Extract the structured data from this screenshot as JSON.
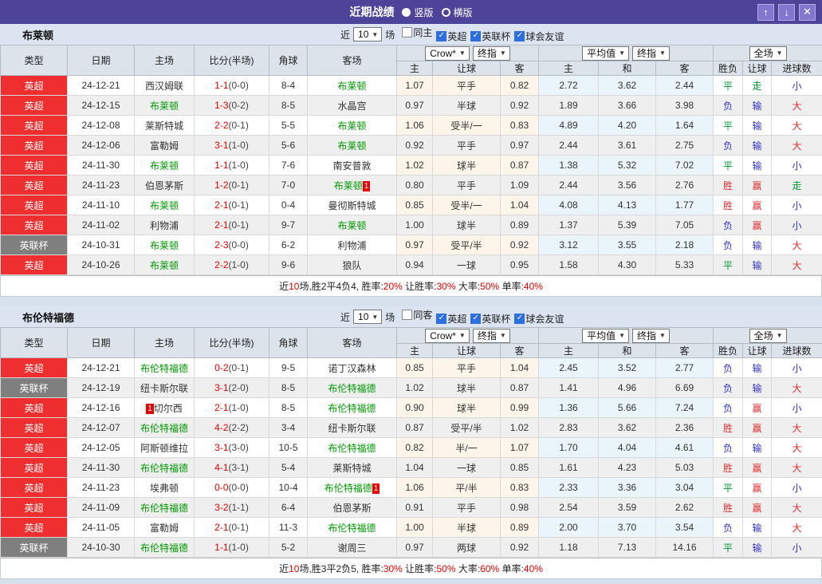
{
  "colors": {
    "accent_purple": "#4d4398",
    "league_red": "#ef2f2f",
    "league_gray": "#7f7f7f",
    "focus_team_green": "#009900",
    "score_red": "#e60000",
    "result_win_red": "#e03030",
    "result_draw_green": "#009933",
    "result_lose_blue": "#3232c8"
  },
  "titlebar": {
    "title": "近期战绩",
    "layout_options": [
      {
        "label": "竖版",
        "selected": true
      },
      {
        "label": "横版",
        "selected": false
      }
    ],
    "buttons": {
      "up": "↑",
      "down": "↓",
      "close": "✕"
    }
  },
  "table_header": {
    "main_cols": [
      "类型",
      "日期",
      "主场",
      "比分(半场)",
      "角球",
      "客场"
    ],
    "group_dropdowns": [
      [
        "Crow*",
        "终指"
      ],
      [
        "平均值",
        "终指"
      ],
      [
        "全场"
      ]
    ],
    "sub_cols": [
      "主",
      "让球",
      "客",
      "主",
      "和",
      "客",
      "胜负",
      "让球",
      "进球数"
    ]
  },
  "outcome_colors": {
    "胜": "win",
    "赢": "win",
    "大": "win",
    "平": "draw",
    "走": "draw",
    "负": "lose",
    "输": "lose",
    "小": "lose"
  },
  "sections": [
    {
      "team": "布莱顿",
      "filter": {
        "prefix": "近",
        "count": "10",
        "suffix": "场",
        "checkboxes": [
          {
            "label": "同主",
            "checked": false
          },
          {
            "label": "英超",
            "checked": true
          },
          {
            "label": "英联杯",
            "checked": true
          },
          {
            "label": "球会友谊",
            "checked": true
          }
        ]
      },
      "rows": [
        {
          "league": "英超",
          "league_type": "red",
          "date": "24-12-21",
          "home": {
            "name": "西汉姆联",
            "focus": false
          },
          "score_ft": "1-1",
          "score_ht": "(0-0)",
          "corners": "8-4",
          "away": {
            "name": "布莱顿",
            "focus": true
          },
          "odds": [
            "1.07",
            "平手",
            "0.82",
            "2.72",
            "3.62",
            "2.44"
          ],
          "outcome": [
            "平",
            "走",
            "小"
          ]
        },
        {
          "league": "英超",
          "league_type": "red",
          "date": "24-12-15",
          "home": {
            "name": "布莱顿",
            "focus": true
          },
          "score_ft": "1-3",
          "score_ht": "(0-2)",
          "corners": "8-5",
          "away": {
            "name": "水晶宫",
            "focus": false
          },
          "odds": [
            "0.97",
            "半球",
            "0.92",
            "1.89",
            "3.66",
            "3.98"
          ],
          "outcome": [
            "负",
            "输",
            "大"
          ]
        },
        {
          "league": "英超",
          "league_type": "red",
          "date": "24-12-08",
          "home": {
            "name": "莱斯特城",
            "focus": false
          },
          "score_ft": "2-2",
          "score_ht": "(0-1)",
          "corners": "5-5",
          "away": {
            "name": "布莱顿",
            "focus": true
          },
          "odds": [
            "1.06",
            "受半/一",
            "0.83",
            "4.89",
            "4.20",
            "1.64"
          ],
          "outcome": [
            "平",
            "输",
            "大"
          ]
        },
        {
          "league": "英超",
          "league_type": "red",
          "date": "24-12-06",
          "home": {
            "name": "富勒姆",
            "focus": false
          },
          "score_ft": "3-1",
          "score_ht": "(1-0)",
          "corners": "5-6",
          "away": {
            "name": "布莱顿",
            "focus": true
          },
          "odds": [
            "0.92",
            "平手",
            "0.97",
            "2.44",
            "3.61",
            "2.75"
          ],
          "outcome": [
            "负",
            "输",
            "大"
          ]
        },
        {
          "league": "英超",
          "league_type": "red",
          "date": "24-11-30",
          "home": {
            "name": "布莱顿",
            "focus": true
          },
          "score_ft": "1-1",
          "score_ht": "(1-0)",
          "corners": "7-6",
          "away": {
            "name": "南安普敦",
            "focus": false
          },
          "odds": [
            "1.02",
            "球半",
            "0.87",
            "1.38",
            "5.32",
            "7.02"
          ],
          "outcome": [
            "平",
            "输",
            "小"
          ]
        },
        {
          "league": "英超",
          "league_type": "red",
          "date": "24-11-23",
          "home": {
            "name": "伯恩茅斯",
            "focus": false
          },
          "score_ft": "1-2",
          "score_ht": "(0-1)",
          "corners": "7-0",
          "away": {
            "name": "布莱顿",
            "focus": true,
            "badge": "1",
            "badge_side": "right"
          },
          "odds": [
            "0.80",
            "平手",
            "1.09",
            "2.44",
            "3.56",
            "2.76"
          ],
          "outcome": [
            "胜",
            "赢",
            "走"
          ]
        },
        {
          "league": "英超",
          "league_type": "red",
          "date": "24-11-10",
          "home": {
            "name": "布莱顿",
            "focus": true
          },
          "score_ft": "2-1",
          "score_ht": "(0-1)",
          "corners": "0-4",
          "away": {
            "name": "曼彻斯特城",
            "focus": false
          },
          "odds": [
            "0.85",
            "受半/一",
            "1.04",
            "4.08",
            "4.13",
            "1.77"
          ],
          "outcome": [
            "胜",
            "赢",
            "小"
          ]
        },
        {
          "league": "英超",
          "league_type": "red",
          "date": "24-11-02",
          "home": {
            "name": "利物浦",
            "focus": false
          },
          "score_ft": "2-1",
          "score_ht": "(0-1)",
          "corners": "9-7",
          "away": {
            "name": "布莱顿",
            "focus": true
          },
          "odds": [
            "1.00",
            "球半",
            "0.89",
            "1.37",
            "5.39",
            "7.05"
          ],
          "outcome": [
            "负",
            "赢",
            "小"
          ]
        },
        {
          "league": "英联杯",
          "league_type": "gray",
          "date": "24-10-31",
          "home": {
            "name": "布莱顿",
            "focus": true
          },
          "score_ft": "2-3",
          "score_ht": "(0-0)",
          "corners": "6-2",
          "away": {
            "name": "利物浦",
            "focus": false
          },
          "odds": [
            "0.97",
            "受平/半",
            "0.92",
            "3.12",
            "3.55",
            "2.18"
          ],
          "outcome": [
            "负",
            "输",
            "大"
          ]
        },
        {
          "league": "英超",
          "league_type": "red",
          "date": "24-10-26",
          "home": {
            "name": "布莱顿",
            "focus": true
          },
          "score_ft": "2-2",
          "score_ht": "(1-0)",
          "corners": "9-6",
          "away": {
            "name": "狼队",
            "focus": false
          },
          "odds": [
            "0.94",
            "一球",
            "0.95",
            "1.58",
            "4.30",
            "5.33"
          ],
          "outcome": [
            "平",
            "输",
            "大"
          ]
        }
      ],
      "summary": [
        {
          "t": "近"
        },
        {
          "t": "10",
          "red": true
        },
        {
          "t": "场,胜2平4负4, 胜率:"
        },
        {
          "t": "20%",
          "red": true
        },
        {
          "t": " 让胜率:"
        },
        {
          "t": "30%",
          "red": true
        },
        {
          "t": " 大率:"
        },
        {
          "t": "50%",
          "red": true
        },
        {
          "t": " 单率:"
        },
        {
          "t": "40%",
          "red": true
        }
      ]
    },
    {
      "team": "布伦特福德",
      "filter": {
        "prefix": "近",
        "count": "10",
        "suffix": "场",
        "checkboxes": [
          {
            "label": "同客",
            "checked": false
          },
          {
            "label": "英超",
            "checked": true
          },
          {
            "label": "英联杯",
            "checked": true
          },
          {
            "label": "球会友谊",
            "checked": true
          }
        ]
      },
      "rows": [
        {
          "league": "英超",
          "league_type": "red",
          "date": "24-12-21",
          "home": {
            "name": "布伦特福德",
            "focus": true
          },
          "score_ft": "0-2",
          "score_ht": "(0-1)",
          "corners": "9-5",
          "away": {
            "name": "诺丁汉森林",
            "focus": false
          },
          "odds": [
            "0.85",
            "平手",
            "1.04",
            "2.45",
            "3.52",
            "2.77"
          ],
          "outcome": [
            "负",
            "输",
            "小"
          ]
        },
        {
          "league": "英联杯",
          "league_type": "gray",
          "date": "24-12-19",
          "home": {
            "name": "纽卡斯尔联",
            "focus": false
          },
          "score_ft": "3-1",
          "score_ht": "(2-0)",
          "corners": "8-5",
          "away": {
            "name": "布伦特福德",
            "focus": true
          },
          "odds": [
            "1.02",
            "球半",
            "0.87",
            "1.41",
            "4.96",
            "6.69"
          ],
          "outcome": [
            "负",
            "输",
            "大"
          ]
        },
        {
          "league": "英超",
          "league_type": "red",
          "date": "24-12-16",
          "home": {
            "name": "切尔西",
            "focus": false,
            "badge": "1",
            "badge_side": "left"
          },
          "score_ft": "2-1",
          "score_ht": "(1-0)",
          "corners": "8-5",
          "away": {
            "name": "布伦特福德",
            "focus": true
          },
          "odds": [
            "0.90",
            "球半",
            "0.99",
            "1.36",
            "5.66",
            "7.24"
          ],
          "outcome": [
            "负",
            "赢",
            "小"
          ]
        },
        {
          "league": "英超",
          "league_type": "red",
          "date": "24-12-07",
          "home": {
            "name": "布伦特福德",
            "focus": true
          },
          "score_ft": "4-2",
          "score_ht": "(2-2)",
          "corners": "3-4",
          "away": {
            "name": "纽卡斯尔联",
            "focus": false
          },
          "odds": [
            "0.87",
            "受平/半",
            "1.02",
            "2.83",
            "3.62",
            "2.36"
          ],
          "outcome": [
            "胜",
            "赢",
            "大"
          ]
        },
        {
          "league": "英超",
          "league_type": "red",
          "date": "24-12-05",
          "home": {
            "name": "阿斯顿维拉",
            "focus": false
          },
          "score_ft": "3-1",
          "score_ht": "(3-0)",
          "corners": "10-5",
          "away": {
            "name": "布伦特福德",
            "focus": true
          },
          "odds": [
            "0.82",
            "半/一",
            "1.07",
            "1.70",
            "4.04",
            "4.61"
          ],
          "outcome": [
            "负",
            "输",
            "大"
          ]
        },
        {
          "league": "英超",
          "league_type": "red",
          "date": "24-11-30",
          "home": {
            "name": "布伦特福德",
            "focus": true
          },
          "score_ft": "4-1",
          "score_ht": "(3-1)",
          "corners": "5-4",
          "away": {
            "name": "莱斯特城",
            "focus": false
          },
          "odds": [
            "1.04",
            "一球",
            "0.85",
            "1.61",
            "4.23",
            "5.03"
          ],
          "outcome": [
            "胜",
            "赢",
            "大"
          ]
        },
        {
          "league": "英超",
          "league_type": "red",
          "date": "24-11-23",
          "home": {
            "name": "埃弗顿",
            "focus": false
          },
          "score_ft": "0-0",
          "score_ht": "(0-0)",
          "corners": "10-4",
          "away": {
            "name": "布伦特福德",
            "focus": true,
            "badge": "1",
            "badge_side": "right"
          },
          "odds": [
            "1.06",
            "平/半",
            "0.83",
            "2.33",
            "3.36",
            "3.04"
          ],
          "outcome": [
            "平",
            "赢",
            "小"
          ]
        },
        {
          "league": "英超",
          "league_type": "red",
          "date": "24-11-09",
          "home": {
            "name": "布伦特福德",
            "focus": true
          },
          "score_ft": "3-2",
          "score_ht": "(1-1)",
          "corners": "6-4",
          "away": {
            "name": "伯恩茅斯",
            "focus": false
          },
          "odds": [
            "0.91",
            "平手",
            "0.98",
            "2.54",
            "3.59",
            "2.62"
          ],
          "outcome": [
            "胜",
            "赢",
            "大"
          ]
        },
        {
          "league": "英超",
          "league_type": "red",
          "date": "24-11-05",
          "home": {
            "name": "富勒姆",
            "focus": false
          },
          "score_ft": "2-1",
          "score_ht": "(0-1)",
          "corners": "11-3",
          "away": {
            "name": "布伦特福德",
            "focus": true
          },
          "odds": [
            "1.00",
            "半球",
            "0.89",
            "2.00",
            "3.70",
            "3.54"
          ],
          "outcome": [
            "负",
            "输",
            "大"
          ]
        },
        {
          "league": "英联杯",
          "league_type": "gray",
          "date": "24-10-30",
          "home": {
            "name": "布伦特福德",
            "focus": true
          },
          "score_ft": "1-1",
          "score_ht": "(1-0)",
          "corners": "5-2",
          "away": {
            "name": "谢周三",
            "focus": false
          },
          "odds": [
            "0.97",
            "两球",
            "0.92",
            "1.18",
            "7.13",
            "14.16"
          ],
          "outcome": [
            "平",
            "输",
            "小"
          ]
        }
      ],
      "summary": [
        {
          "t": "近"
        },
        {
          "t": "10",
          "red": true
        },
        {
          "t": "场,胜3平2负5, 胜率:"
        },
        {
          "t": "30%",
          "red": true
        },
        {
          "t": " 让胜率:"
        },
        {
          "t": "50%",
          "red": true
        },
        {
          "t": " 大率:"
        },
        {
          "t": "60%",
          "red": true
        },
        {
          "t": " 单率:"
        },
        {
          "t": "40%",
          "red": true
        }
      ]
    }
  ]
}
